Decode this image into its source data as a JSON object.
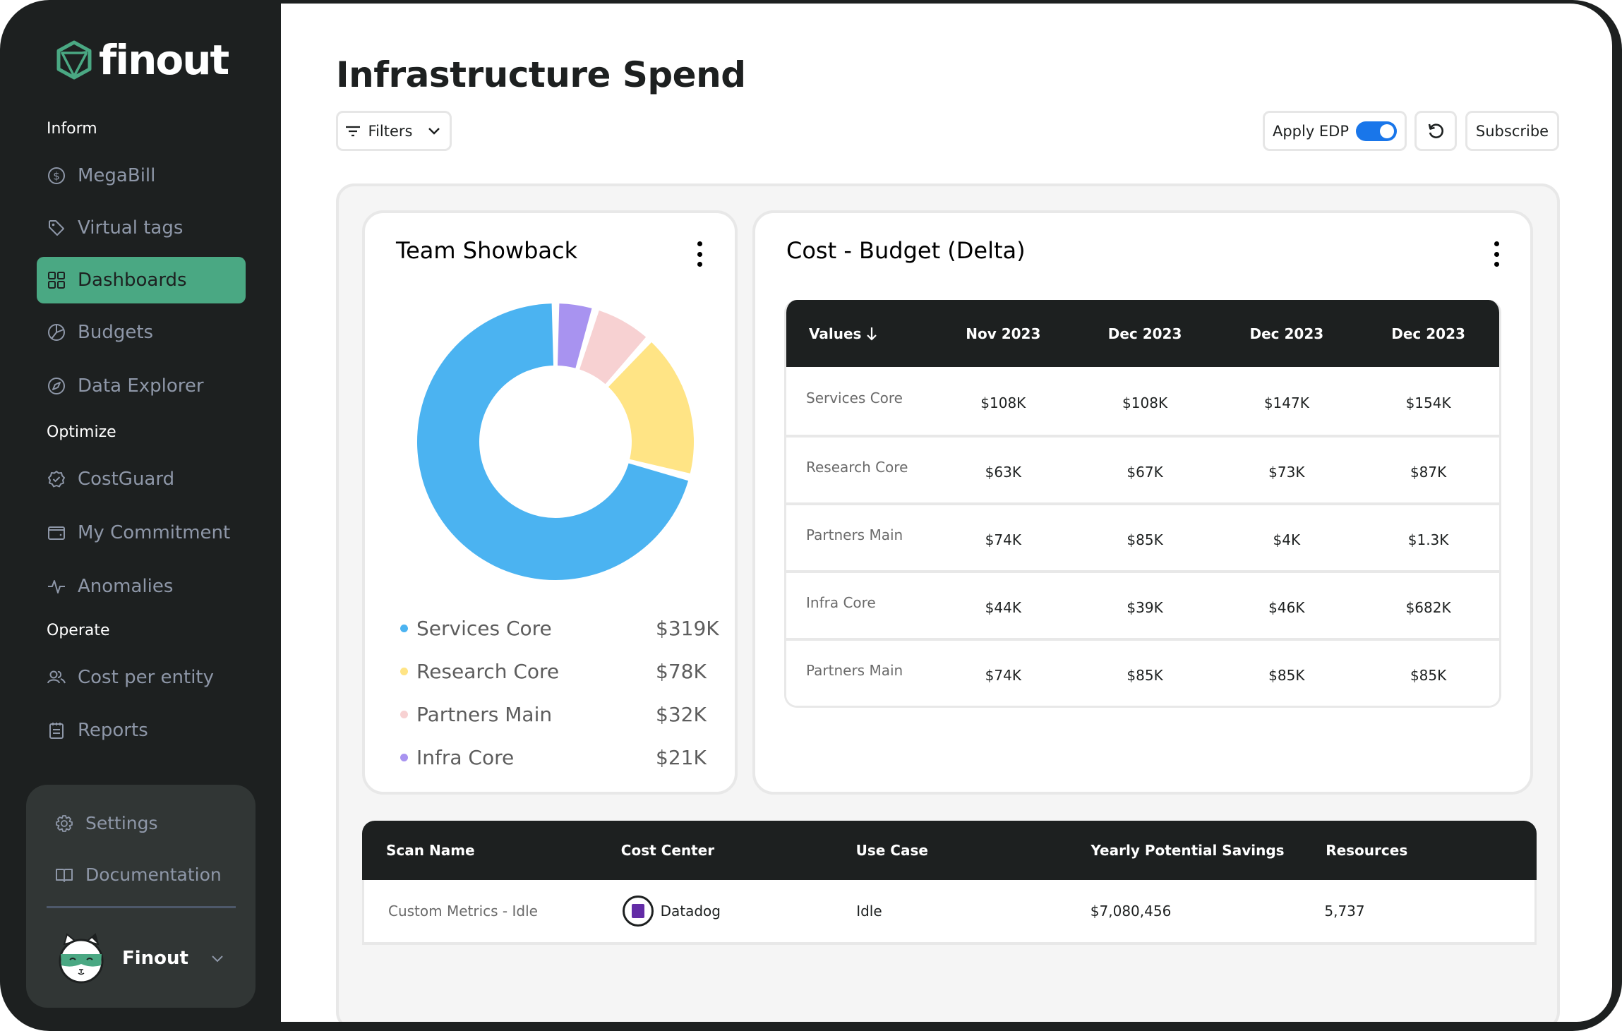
{
  "app": {
    "brand": "finout"
  },
  "sidebar": {
    "sections": [
      {
        "label": "Inform",
        "items": [
          {
            "label": "MegaBill",
            "icon": "dollar-circle-icon",
            "active": false
          },
          {
            "label": "Virtual tags",
            "icon": "tag-icon",
            "active": false
          },
          {
            "label": "Dashboards",
            "icon": "grid-icon",
            "active": true
          },
          {
            "label": "Budgets",
            "icon": "pie-icon",
            "active": false
          },
          {
            "label": "Data Explorer",
            "icon": "compass-icon",
            "active": false
          }
        ]
      },
      {
        "label": "Optimize",
        "items": [
          {
            "label": "CostGuard",
            "icon": "badge-check-icon",
            "active": false
          },
          {
            "label": "My Commitment",
            "icon": "wallet-icon",
            "active": false
          },
          {
            "label": "Anomalies",
            "icon": "activity-icon",
            "active": false
          }
        ]
      },
      {
        "label": "Operate",
        "items": [
          {
            "label": "Cost per entity",
            "icon": "users-icon",
            "active": false
          },
          {
            "label": "Reports",
            "icon": "calendar-doc-icon",
            "active": false
          }
        ]
      }
    ],
    "bottom": {
      "settings_label": "Settings",
      "documentation_label": "Documentation",
      "user_name": "Finout"
    }
  },
  "header": {
    "title": "Infrastructure Spend",
    "filters_label": "Filters",
    "apply_edp_label": "Apply EDP",
    "apply_edp_on": true,
    "subscribe_label": "Subscribe"
  },
  "colors": {
    "sidebar_bg": "#1d2020",
    "accent_green": "#4aa883",
    "toggle_blue": "#1976ea"
  },
  "showback": {
    "title": "Team Showback",
    "chart_data": {
      "type": "pie",
      "title": "Team Showback",
      "donut": true,
      "legend": "bottom",
      "slices": [
        {
          "label": "Services Core",
          "value": 319,
          "display": "$319K",
          "color": "#4bb3f1"
        },
        {
          "label": "Research Core",
          "value": 78,
          "display": "$78K",
          "color": "#ffe485"
        },
        {
          "label": "Partners Main",
          "value": 32,
          "display": "$32K",
          "color": "#f7d1d2"
        },
        {
          "label": "Infra Core",
          "value": 21,
          "display": "$21K",
          "color": "#a893f0"
        }
      ],
      "units": "USD thousands"
    }
  },
  "budget": {
    "title": "Cost - Budget (Delta)",
    "columns": [
      "Values",
      "Nov 2023",
      "Dec 2023",
      "Dec 2023",
      "Dec 2023"
    ],
    "sort_column": "Values",
    "sort_direction": "descending",
    "rows": [
      {
        "name": "Services Core",
        "values": [
          "$108K",
          "$108K",
          "$147K",
          "$154K"
        ]
      },
      {
        "name": "Research Core",
        "values": [
          "$63K",
          "$67K",
          "$73K",
          "$87K"
        ]
      },
      {
        "name": "Partners Main",
        "values": [
          "$74K",
          "$85K",
          "$4K",
          "$1.3K"
        ]
      },
      {
        "name": "Infra Core",
        "values": [
          "$44K",
          "$39K",
          "$46K",
          "$682K"
        ]
      },
      {
        "name": "Partners Main",
        "values": [
          "$74K",
          "$85K",
          "$85K",
          "$85K"
        ]
      }
    ]
  },
  "scans": {
    "columns": [
      "Scan Name",
      "Cost Center",
      "Use Case",
      "Yearly Potential Savings",
      "Resources"
    ],
    "rows": [
      {
        "scan_name": "Custom Metrics - Idle",
        "cost_center": "Datadog",
        "cost_center_icon": "datadog-logo-icon",
        "use_case": "Idle",
        "savings": "$7,080,456",
        "resources": "5,737"
      }
    ]
  }
}
